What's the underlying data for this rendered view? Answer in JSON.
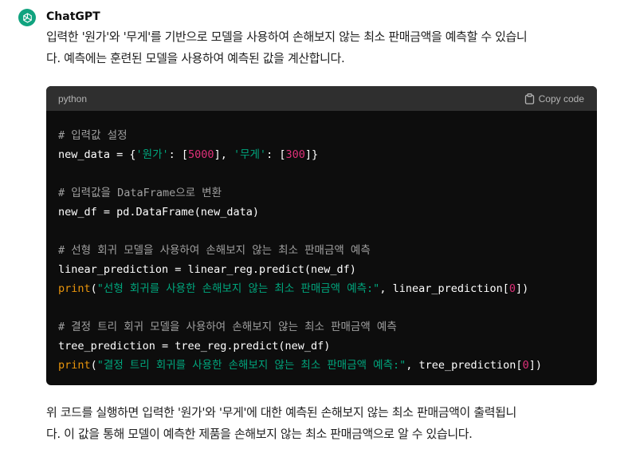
{
  "message": {
    "author": "ChatGPT",
    "intro": [
      "입력한 '원가'와 '무게'를 기반으로 모델을 사용하여 손해보지 않는 최소 판매금액을 예측할 수 있습니",
      "다. 예측에는 훈련된 모델을 사용하여 예측된 값을 계산합니다."
    ],
    "outro": [
      "위 코드를 실행하면 입력한 '원가'와 '무게'에 대한 예측된 손해보지 않는 최소 판매금액이 출력됩니",
      "다. 이 값을 통해 모델이 예측한 제품을 손해보지 않는 최소 판매금액으로 알 수 있습니다."
    ]
  },
  "code_block": {
    "language": "python",
    "copy_label": "Copy code",
    "lines": [
      [
        {
          "t": "comment",
          "v": "# 입력값 설정"
        }
      ],
      [
        {
          "t": "plain",
          "v": "new_data = {"
        },
        {
          "t": "str",
          "v": "'원가'"
        },
        {
          "t": "plain",
          "v": ": ["
        },
        {
          "t": "num",
          "v": "5000"
        },
        {
          "t": "plain",
          "v": "], "
        },
        {
          "t": "str",
          "v": "'무게'"
        },
        {
          "t": "plain",
          "v": ": ["
        },
        {
          "t": "num",
          "v": "300"
        },
        {
          "t": "plain",
          "v": "]}"
        }
      ],
      [],
      [
        {
          "t": "comment",
          "v": "# 입력값을 DataFrame으로 변환"
        }
      ],
      [
        {
          "t": "plain",
          "v": "new_df = pd.DataFrame(new_data)"
        }
      ],
      [],
      [
        {
          "t": "comment",
          "v": "# 선형 회귀 모델을 사용하여 손해보지 않는 최소 판매금액 예측"
        }
      ],
      [
        {
          "t": "plain",
          "v": "linear_prediction = linear_reg.predict(new_df)"
        }
      ],
      [
        {
          "t": "fn",
          "v": "print"
        },
        {
          "t": "plain",
          "v": "("
        },
        {
          "t": "str",
          "v": "\"선형 회귀를 사용한 손해보지 않는 최소 판매금액 예측:\""
        },
        {
          "t": "plain",
          "v": ", linear_prediction["
        },
        {
          "t": "num",
          "v": "0"
        },
        {
          "t": "plain",
          "v": "])"
        }
      ],
      [],
      [
        {
          "t": "comment",
          "v": "# 결정 트리 회귀 모델을 사용하여 손해보지 않는 최소 판매금액 예측"
        }
      ],
      [
        {
          "t": "plain",
          "v": "tree_prediction = tree_reg.predict(new_df)"
        }
      ],
      [
        {
          "t": "fn",
          "v": "print"
        },
        {
          "t": "plain",
          "v": "("
        },
        {
          "t": "str",
          "v": "\"결정 트리 회귀를 사용한 손해보지 않는 최소 판매금액 예측:\""
        },
        {
          "t": "plain",
          "v": ", tree_prediction["
        },
        {
          "t": "num",
          "v": "0"
        },
        {
          "t": "plain",
          "v": "])"
        }
      ]
    ]
  },
  "colors": {
    "avatar_bg": "#10a37f",
    "code_bg": "#0d0d0d",
    "code_header_bg": "#2f2f2f",
    "comment": "#a0a0a0",
    "string": "#00a67d",
    "number": "#df3079",
    "function": "#e9950c"
  },
  "icons": {
    "avatar": "openai-logo-icon",
    "copy": "clipboard-icon"
  }
}
